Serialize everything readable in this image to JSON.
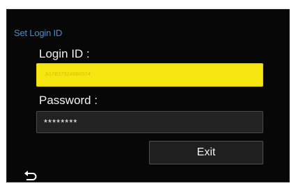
{
  "screen": {
    "title": "Set Login ID"
  },
  "form": {
    "login_label": "Login ID :",
    "login_value": "A17B275248B0574",
    "password_label": "Password :",
    "password_value": "********"
  },
  "actions": {
    "exit_label": "Exit",
    "back_icon": "return-arrow-icon"
  },
  "colors": {
    "accent_blue": "#3f8edb",
    "highlight_yellow": "#f5e510",
    "background": "#070707"
  }
}
